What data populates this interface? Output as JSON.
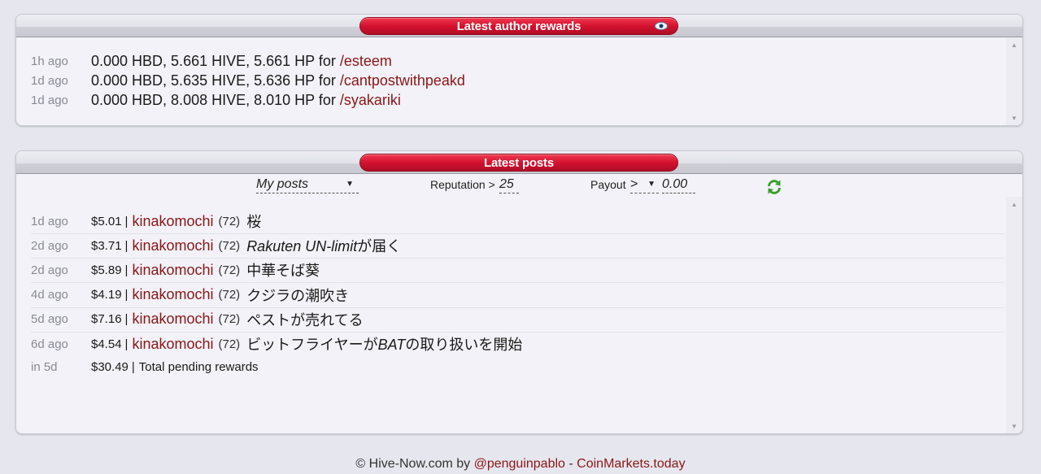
{
  "rewards_panel": {
    "title": "Latest author rewards",
    "toggle_icon": "eye-icon",
    "rows": [
      {
        "age": "1h ago",
        "text": "0.000 HBD, 5.661 HIVE, 5.661 HP for",
        "link": "/esteem"
      },
      {
        "age": "1d ago",
        "text": "0.000 HBD, 5.635 HIVE, 5.636 HP for",
        "link": "/cantpostwithpeakd"
      },
      {
        "age": "1d ago",
        "text": "0.000 HBD, 8.008 HIVE, 8.010 HP for",
        "link": "/syakariki"
      }
    ]
  },
  "posts_panel": {
    "title": "Latest posts",
    "filter_posts": "My posts",
    "filter_posts_arrow": "▼",
    "reputation_label": "Reputation >",
    "reputation_value": "25",
    "payout_label": "Payout",
    "payout_op": ">",
    "payout_arrow": "▼",
    "payout_value": "0.00",
    "refresh_icon": "refresh-icon",
    "rows": [
      {
        "age": "1d ago",
        "price": "$5.01",
        "author": "kinakomochi",
        "rep": "(72)",
        "title_parts": [
          {
            "t": "桜",
            "i": false
          }
        ]
      },
      {
        "age": "2d ago",
        "price": "$3.71",
        "author": "kinakomochi",
        "rep": "(72)",
        "title_parts": [
          {
            "t": "Rakuten UN-limit",
            "i": true
          },
          {
            "t": "が届く",
            "i": false
          }
        ]
      },
      {
        "age": "2d ago",
        "price": "$5.89",
        "author": "kinakomochi",
        "rep": "(72)",
        "title_parts": [
          {
            "t": "中華そば葵",
            "i": false
          }
        ]
      },
      {
        "age": "4d ago",
        "price": "$4.19",
        "author": "kinakomochi",
        "rep": "(72)",
        "title_parts": [
          {
            "t": "クジラの潮吹き",
            "i": false
          }
        ]
      },
      {
        "age": "5d ago",
        "price": "$7.16",
        "author": "kinakomochi",
        "rep": "(72)",
        "title_parts": [
          {
            "t": "ペストが売れてる",
            "i": false
          }
        ]
      },
      {
        "age": "6d ago",
        "price": "$4.54",
        "author": "kinakomochi",
        "rep": "(72)",
        "title_parts": [
          {
            "t": "ビットフライヤーが",
            "i": false
          },
          {
            "t": "BAT",
            "i": true
          },
          {
            "t": "の取り扱いを開始",
            "i": false
          }
        ]
      }
    ],
    "total": {
      "age": "in 5d",
      "price": "$30.49",
      "label": "Total pending rewards"
    }
  },
  "footer": {
    "prefix": "© Hive-Now.com by",
    "author_link": "@penguinpablo",
    "dash": "-",
    "site_link": "CoinMarkets.today"
  },
  "colors": {
    "accent": "#d31230",
    "link": "#8b1616",
    "background": "#e6e6ee"
  }
}
